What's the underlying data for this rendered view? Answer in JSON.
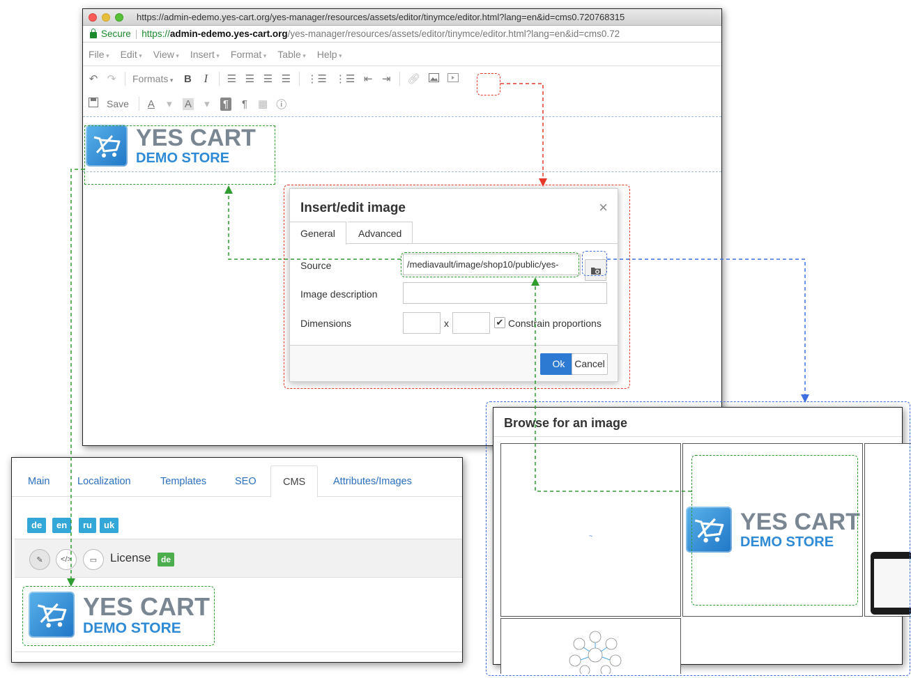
{
  "browser": {
    "title_url": "https://admin-edemo.yes-cart.org/yes-manager/resources/assets/editor/tinymce/editor.html?lang=en&id=cms0.720768315",
    "secure_label": "Secure",
    "url_scheme": "https://",
    "url_host": "admin-edemo.yes-cart.org",
    "url_path": "/yes-manager/resources/assets/editor/tinymce/editor.html?lang=en&id=cms0.72"
  },
  "menu": {
    "file": "File",
    "edit": "Edit",
    "view": "View",
    "insert": "Insert",
    "format": "Format",
    "table": "Table",
    "help": "Help"
  },
  "toolbar": {
    "formats": "Formats",
    "bold": "B",
    "italic": "I",
    "save": "Save",
    "font_color": "A",
    "bg_color": "A",
    "pilcrow": "¶"
  },
  "logo": {
    "line1": "YES CART",
    "line2": "DEMO STORE"
  },
  "dialog": {
    "title": "Insert/edit image",
    "close": "×",
    "tabs": [
      "General",
      "Advanced"
    ],
    "source_label": "Source",
    "source_value": "/mediavault/image/shop10/public/yes-",
    "description_label": "Image description",
    "description_value": "",
    "dimensions_label": "Dimensions",
    "width_value": "",
    "height_value": "",
    "dim_separator": "x",
    "constrain_checked": true,
    "constrain_label": "Constrain proportions",
    "ok": "Ok",
    "cancel": "Cancel"
  },
  "admin": {
    "tabs": [
      "Main",
      "Localization",
      "Templates",
      "SEO",
      "CMS",
      "Attributes/Images"
    ],
    "active_tab": "CMS",
    "languages": [
      "de",
      "en",
      "ru",
      "uk"
    ],
    "item_name": "License",
    "item_lang": "de"
  },
  "browse": {
    "title": "Browse for an image"
  },
  "colors": {
    "annotation_green": "#2e9c2e",
    "annotation_red": "#e6392a",
    "annotation_blue": "#3d6fe3",
    "primary_button": "#2d7ad2",
    "lang_badge": "#33a7d8",
    "badge_green": "#4cae4c"
  }
}
